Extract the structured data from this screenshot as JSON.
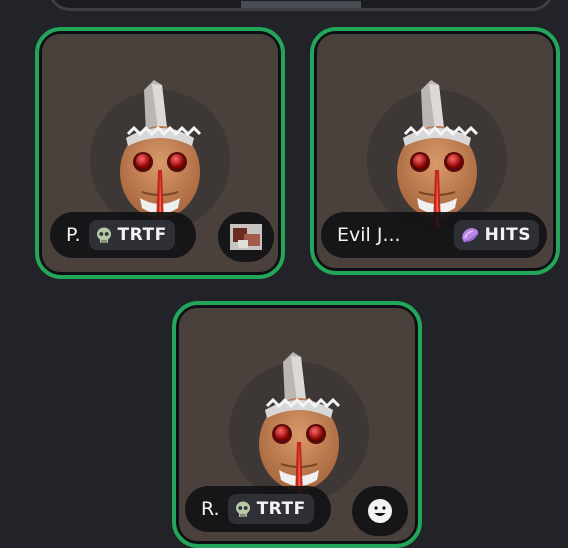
{
  "participants": [
    {
      "name": "P.",
      "tag_icon": "skull-icon",
      "tag": "TRTF",
      "side_item": "thumbnail"
    },
    {
      "name": "Evil J...",
      "tag_icon": "crystal-icon",
      "tag": "HITS"
    },
    {
      "name": "R.",
      "tag_icon": "skull-icon",
      "tag": "TRTF",
      "side_item": "smiley-icon"
    }
  ],
  "colors": {
    "speaking_border": "#23a55a",
    "tile_bg": "#4a413d",
    "page_bg": "#222229"
  }
}
